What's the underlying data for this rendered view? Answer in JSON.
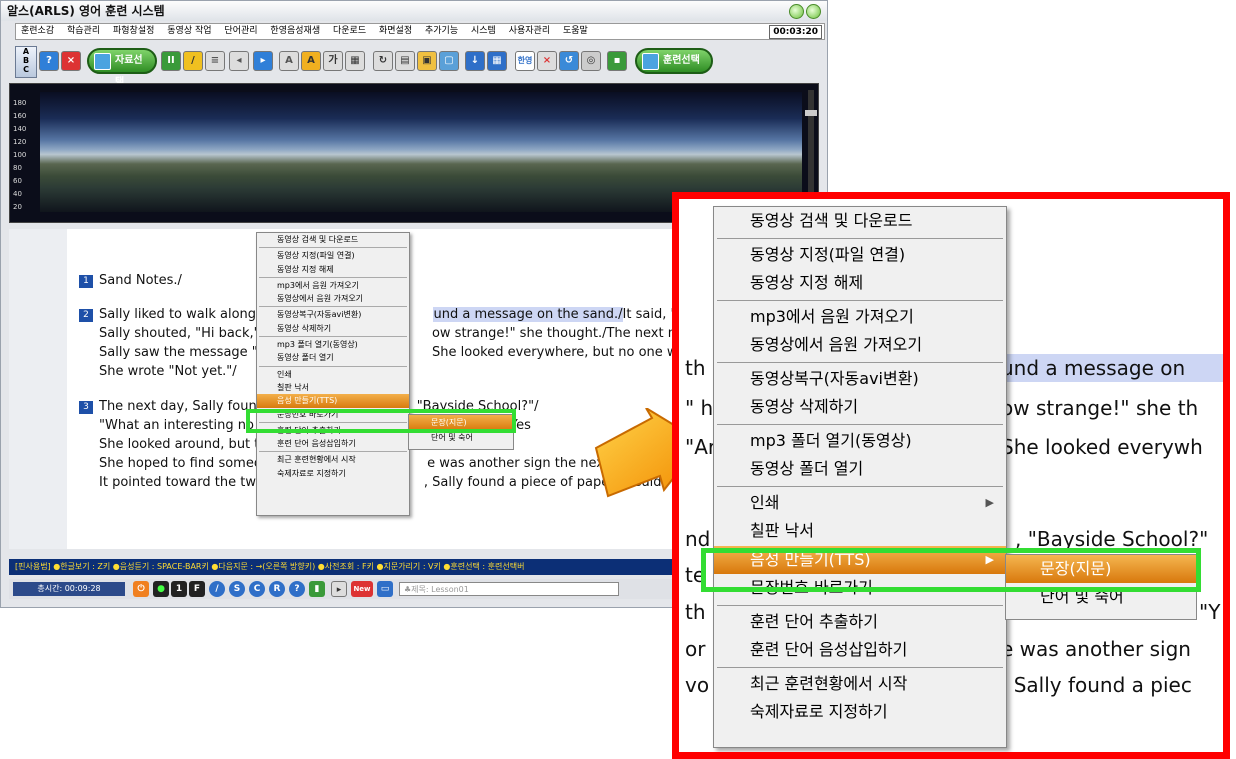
{
  "window": {
    "title": "알스(ARLS) 영어 훈련 시스템"
  },
  "menubar": {
    "items": [
      "훈련소감",
      "학습관리",
      "파형창설정",
      "동영상 작업",
      "단어관리",
      "한영음성재생",
      "다운로드",
      "화면설정",
      "추가기능",
      "시스템",
      "사용자관리",
      "도움말"
    ],
    "clock": "00:03:20"
  },
  "abc": {
    "a": "A",
    "b": "B",
    "c": "C"
  },
  "toolbar": {
    "data_select_label": "자료선택",
    "training_select_label": "훈련선택",
    "han_label": "한영",
    "font_label": "가"
  },
  "viewer": {
    "axis_ticks": [
      "180",
      "160",
      "140",
      "120",
      "100",
      "80",
      "60",
      "40",
      "20"
    ]
  },
  "document": {
    "p1_num": "1",
    "p1_line1": "Sand Notes./",
    "p2_num": "2",
    "p2_line1_a": "Sally liked to walk along th",
    "p2_line1_hl": "und a message on the sand./",
    "p2_line1_b": "It said, \"Hi.\"/",
    "p2_line2_a": "Sally shouted, \"Hi back,\" h",
    "p2_line2_b": "ow strange!\" she thought./The next morning",
    "p2_line3_a": "Sally saw the message \"Ar",
    "p2_line3_b": "She looked everywhere, but no one was ther",
    "p2_line4": "She wrote \"Not yet.\"/",
    "p3_num": "3",
    "p3_line1_a": "The next day, Sally foun",
    "p3_line1_b": "\"Bayside School?\"/",
    "p3_line2_a": "\"What an interesting no",
    "p3_line2_b": "\"Yes",
    "p3_line3": "She looked around, but th",
    "p3_line4_a": "She hoped to find someor",
    "p3_line4_b": "e was another sign the next",
    "p3_line5_a": "It pointed toward the two",
    "p3_line5_b": ", Sally found a piece of paper./It said, \"Tom"
  },
  "context_menu": {
    "items": [
      "동영상 검색 및 다운로드",
      "동영상 지정(파일 연결)",
      "동영상 지정 해제",
      "mp3에서 음원 가져오기",
      "동영상에서 음원 가져오기",
      "동영상복구(자동avi변환)",
      "동영상 삭제하기",
      "mp3 폴더 열기(동영상)",
      "동영상 폴더 열기",
      "인쇄",
      "칠판 낙서",
      "음성 만들기(TTS)",
      "문장번호 바로가기",
      "훈련 단어 추출하기",
      "훈련 단어 음성삽입하기",
      "최근 훈련현황에서 시작",
      "숙제자료로 지정하기"
    ],
    "submenu": [
      "문장(지문)",
      "단어 및 숙어"
    ]
  },
  "statusbar": {
    "text": "[핀사용법] ●한글보기 : Z키    ●음성듣기 : SPACE-BAR키    ●다음지문 : →(오른쪽 방향키)    ●사전조회 : F키    ●지문가리기 : V키    ●훈련선택 : 훈련선택버"
  },
  "bottombar": {
    "time_label": "총시간: 00:09:28",
    "num1": "1",
    "letter_f": "F",
    "letter_s": "S",
    "letter_c": "C",
    "letter_r": "R",
    "help": "?",
    "new_label": "New",
    "lesson_label": "♣제목: Lesson01"
  },
  "zoom": {
    "text_a": "th",
    "text_b": "und a message on",
    "text_c": "\" h",
    "text_d": "ow strange!\" she th",
    "text_e": "\"Ar",
    "text_f": "She looked everywh",
    "text_g": "nd",
    "text_h": ", \"Bayside School?\"",
    "text_i": "te",
    "text_j": "th",
    "text_k": "\"Y",
    "text_l": "or",
    "text_m": "e was another sign",
    "text_n": "vo",
    "text_o": ", Sally found a piec"
  },
  "colors": {
    "highlight_green": "#33dd33",
    "zoom_border": "#ff0000",
    "selected_orange": "#d87a0e"
  }
}
